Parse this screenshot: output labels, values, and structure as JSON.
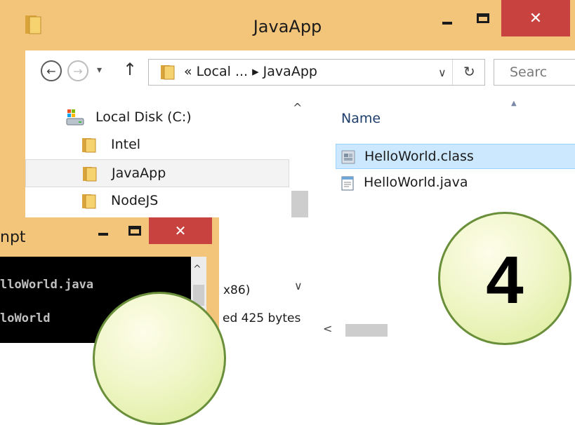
{
  "explorer": {
    "title": "JavaApp",
    "address": {
      "path_text": "« Local ... ▸ JavaApp",
      "dropdown_glyph": "∨",
      "refresh_glyph": "↻"
    },
    "search_placeholder": "Searc",
    "nav_buttons": {
      "back": "←",
      "forward": "→",
      "recent": "▾",
      "up": "↑"
    },
    "tree": [
      {
        "label": "Local Disk (C:)",
        "icon": "drive-icon"
      },
      {
        "label": "Intel",
        "icon": "folder-icon"
      },
      {
        "label": "JavaApp",
        "icon": "folder-icon",
        "selected": true
      },
      {
        "label": "NodeJS",
        "icon": "folder-icon"
      }
    ],
    "column_header": "Name",
    "files": [
      {
        "name": "HelloWorld.class",
        "icon": "class-file-icon",
        "selected": true
      },
      {
        "name": "HelloWorld.java",
        "icon": "java-file-icon"
      }
    ],
    "partial_tree_text": "x86)",
    "status_size": "ed  425 bytes",
    "scroll_glyphs": {
      "up": "^",
      "down": "∨",
      "left": "<"
    },
    "window_controls": {
      "close": "✕"
    }
  },
  "cmd": {
    "title": "npt",
    "lines": [
      "lloWorld.java",
      "loWorld"
    ],
    "window_controls": {
      "close": "✕"
    }
  },
  "badges": [
    {
      "number": "4"
    }
  ],
  "colors": {
    "frame": "#f3c57a",
    "close_button": "#c84340",
    "selection": "#cce8ff",
    "badge_border": "#6a8f3a"
  }
}
